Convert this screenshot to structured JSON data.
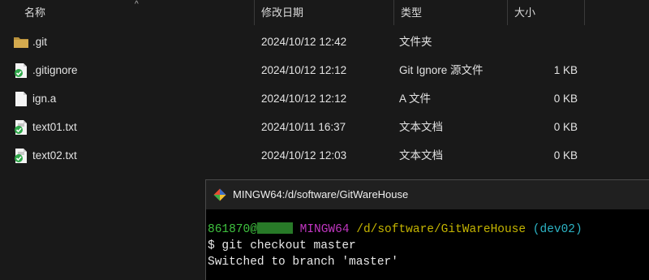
{
  "columns": {
    "name": "名称",
    "date": "修改日期",
    "type": "类型",
    "size": "大小"
  },
  "sort_indicator": "^",
  "files": [
    {
      "name": ".git",
      "date": "2024/10/12 12:42",
      "type": "文件夹",
      "size": "",
      "icon": "folder-icon"
    },
    {
      "name": ".gitignore",
      "date": "2024/10/12 12:12",
      "type": "Git Ignore 源文件",
      "size": "1 KB",
      "icon": "git-file-icon"
    },
    {
      "name": "ign.a",
      "date": "2024/10/12 12:12",
      "type": "A 文件",
      "size": "0 KB",
      "icon": "file-icon"
    },
    {
      "name": "text01.txt",
      "date": "2024/10/11 16:37",
      "type": "文本文档",
      "size": "0 KB",
      "icon": "git-file-icon"
    },
    {
      "name": "text02.txt",
      "date": "2024/10/12 12:03",
      "type": "文本文档",
      "size": "0 KB",
      "icon": "git-file-icon"
    }
  ],
  "terminal": {
    "title": "MINGW64:/d/software/GitWareHouse",
    "prompt_user": "861870@",
    "prompt_env": "MINGW64",
    "prompt_path": "/d/software/GitWareHouse",
    "prompt_branch": "(dev02)",
    "command": "$ git checkout master",
    "output": "Switched to branch 'master'"
  },
  "colors": {
    "background": "#191919",
    "text": "#e3e3e3",
    "folder": "#c8a24a",
    "git_check": "#3fb43f",
    "terminal_green": "#3fc23f",
    "terminal_magenta": "#c136c1",
    "terminal_yellow": "#c4b400",
    "terminal_cyan": "#2cb3c4"
  }
}
